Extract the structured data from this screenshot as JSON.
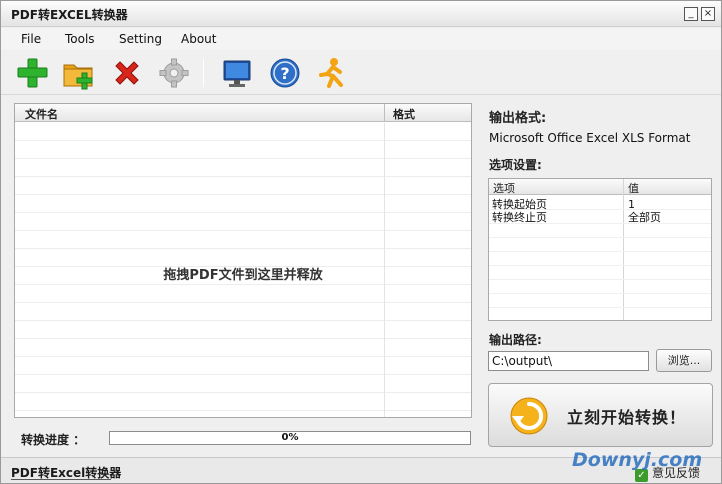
{
  "window": {
    "title": "PDF转EXCEL转换器",
    "minimize_glyph": "_",
    "close_glyph": "×"
  },
  "menu": [
    "File",
    "Tools",
    "Setting",
    "About"
  ],
  "toolbar": {
    "buttons": [
      {
        "name": "add-file-icon",
        "color": "#2db32d"
      },
      {
        "name": "add-folder-icon",
        "color": "#e8a21a"
      },
      {
        "name": "remove-icon",
        "color": "#d9261c"
      },
      {
        "name": "settings-gear-icon",
        "color": "#b8b8b8"
      },
      {
        "name": "monitor-icon",
        "color": "#2f6fc8"
      },
      {
        "name": "help-icon",
        "color": "#2f6fc8"
      },
      {
        "name": "runner-icon",
        "color": "#f2a413"
      }
    ]
  },
  "file_list": {
    "columns": [
      "文件名",
      "格式"
    ],
    "drop_hint": "拖拽PDF文件到这里并释放"
  },
  "progress": {
    "label": "转换进度 ：",
    "percent": 0,
    "text": "0%",
    "fill_color": "#3a9b3a"
  },
  "right_panel": {
    "output_format_label": "输出格式:",
    "output_format_value": "Microsoft Office Excel XLS Format",
    "options_label": "选项设置:",
    "options_columns": [
      "选项",
      "值"
    ],
    "options_rows": [
      {
        "option": "转换起始页",
        "value": "1"
      },
      {
        "option": "转换终止页",
        "value": "全部页"
      }
    ],
    "output_path_label": "输出路径:",
    "output_path_value": "C:\\output\\",
    "browse_label": "浏览...",
    "start_label": "立刻开始转换！"
  },
  "statusbar": {
    "title": "PDF转Excel转换器",
    "feedback": "意见反馈"
  },
  "watermark": "Downyj.com"
}
